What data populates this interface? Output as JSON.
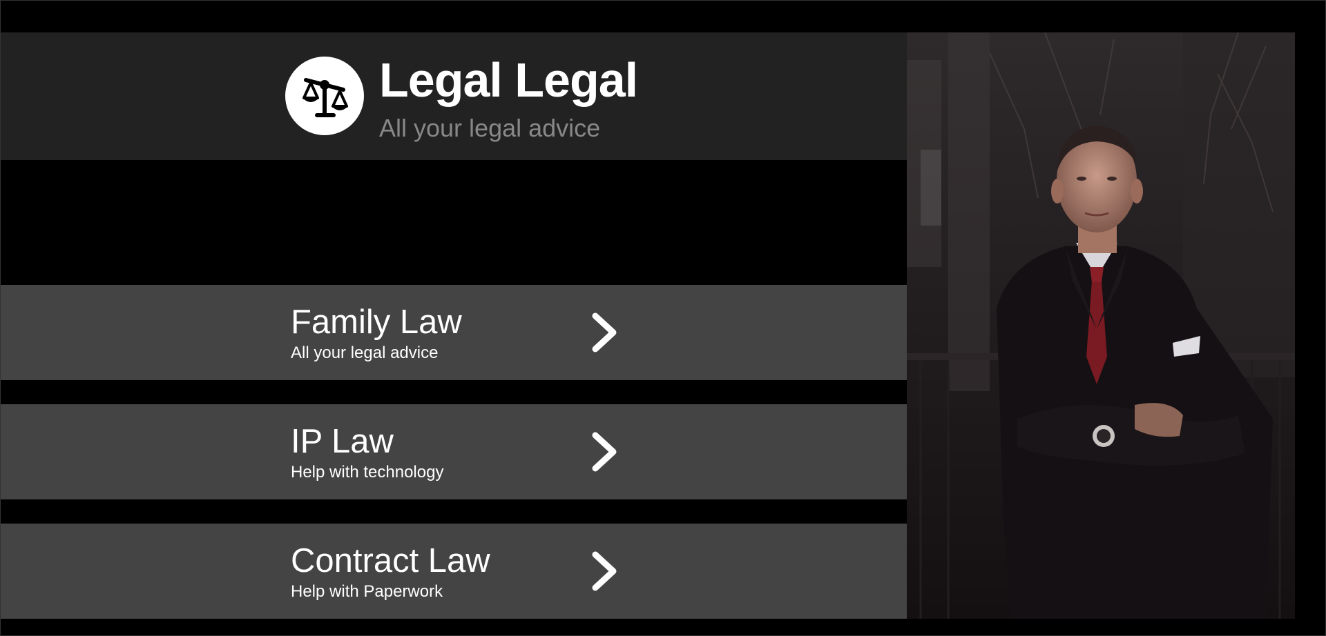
{
  "brand": {
    "title": "Legal Legal",
    "subtitle": "All your legal advice",
    "logo_icon": "scales-of-justice-icon"
  },
  "services": [
    {
      "title": "Family Law",
      "subtitle": "All your legal advice",
      "icon": "chevron-right-icon"
    },
    {
      "title": "IP Law",
      "subtitle": "Help with technology",
      "icon": "chevron-right-icon"
    },
    {
      "title": "Contract Law",
      "subtitle": "Help with Paperwork",
      "icon": "chevron-right-icon"
    }
  ],
  "hero_image": {
    "subject": "man-in-suit-photo"
  },
  "colors": {
    "background": "#000000",
    "header": "#222222",
    "service_card": "#444444",
    "text": "#ffffff",
    "subtitle": "#888888"
  }
}
